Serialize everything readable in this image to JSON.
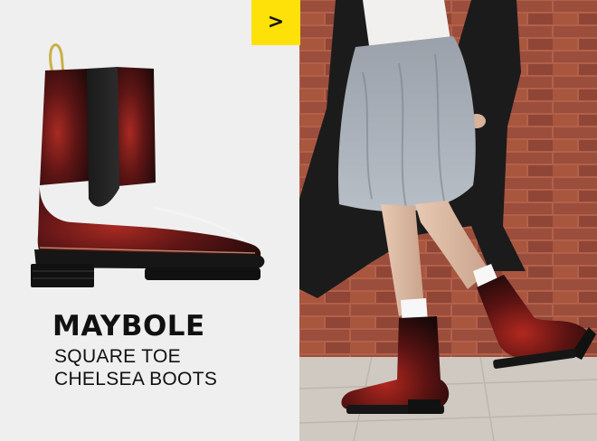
{
  "product": {
    "name": "MAYBOLE",
    "subtitle_line1": "SQUARE TOE",
    "subtitle_line2": "CHELSEA BOOTS"
  },
  "cta": {
    "glyph": ">",
    "icon": "chevron-right-icon",
    "color": "#ffe10a"
  },
  "colors": {
    "left_background": "#efefef",
    "boot_leather": "#3a0f10",
    "boot_highlight": "#8c1f1c",
    "brick_wall": "#8c4a3c",
    "pavement": "#cfc9c1"
  }
}
